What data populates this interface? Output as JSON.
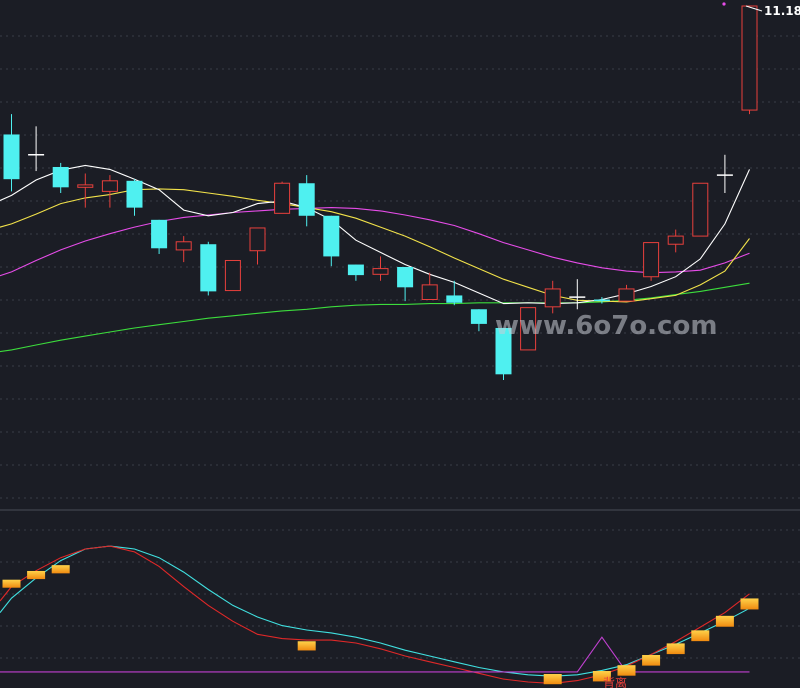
{
  "chart_data": [
    {
      "type": "candlestick",
      "title": "",
      "price_label": "11.18",
      "watermark": "www.6o7o.com",
      "ylim": [
        5.6,
        11.4
      ],
      "colors": {
        "up": "#e8403c",
        "down": "#4ff0f0",
        "doji": "#ffffff",
        "ma5": "#ffffff",
        "ma10": "#f2e24a",
        "ma20": "#e64ce8",
        "ma60": "#3cdc3c",
        "grid": "#3a3d48",
        "background": "#1b1d25"
      },
      "candles": [
        {
          "o": 9.6,
          "h": 9.85,
          "l": 8.9,
          "c": 9.05
        },
        {
          "o": 9.35,
          "h": 9.7,
          "l": 9.15,
          "c": 9.35
        },
        {
          "o": 9.2,
          "h": 9.25,
          "l": 8.88,
          "c": 8.95
        },
        {
          "o": 8.95,
          "h": 9.12,
          "l": 8.7,
          "c": 8.98
        },
        {
          "o": 8.9,
          "h": 9.1,
          "l": 8.7,
          "c": 9.03
        },
        {
          "o": 9.03,
          "h": 9.05,
          "l": 8.6,
          "c": 8.7
        },
        {
          "o": 8.55,
          "h": 8.55,
          "l": 8.13,
          "c": 8.2
        },
        {
          "o": 8.18,
          "h": 8.35,
          "l": 8.03,
          "c": 8.28
        },
        {
          "o": 8.25,
          "h": 8.28,
          "l": 7.62,
          "c": 7.67
        },
        {
          "o": 7.68,
          "h": 8.05,
          "l": 7.68,
          "c": 8.05
        },
        {
          "o": 8.17,
          "h": 8.45,
          "l": 8.0,
          "c": 8.45
        },
        {
          "o": 8.63,
          "h": 9.02,
          "l": 8.63,
          "c": 9.0
        },
        {
          "o": 9.0,
          "h": 9.1,
          "l": 8.47,
          "c": 8.6
        },
        {
          "o": 8.6,
          "h": 8.6,
          "l": 7.98,
          "c": 8.1
        },
        {
          "o": 8.0,
          "h": 8.0,
          "l": 7.8,
          "c": 7.87
        },
        {
          "o": 7.88,
          "h": 8.1,
          "l": 7.8,
          "c": 7.95
        },
        {
          "o": 7.97,
          "h": 7.97,
          "l": 7.55,
          "c": 7.72
        },
        {
          "o": 7.57,
          "h": 7.9,
          "l": 7.57,
          "c": 7.75
        },
        {
          "o": 7.62,
          "h": 7.8,
          "l": 7.5,
          "c": 7.53
        },
        {
          "o": 7.45,
          "h": 7.45,
          "l": 7.18,
          "c": 7.27
        },
        {
          "o": 7.22,
          "h": 7.22,
          "l": 6.58,
          "c": 6.65
        },
        {
          "o": 6.95,
          "h": 7.47,
          "l": 6.95,
          "c": 7.47
        },
        {
          "o": 7.48,
          "h": 7.8,
          "l": 7.4,
          "c": 7.7
        },
        {
          "o": 7.6,
          "h": 7.82,
          "l": 7.45,
          "c": 7.6
        },
        {
          "o": 7.57,
          "h": 7.6,
          "l": 7.52,
          "c": 7.55
        },
        {
          "o": 7.55,
          "h": 7.75,
          "l": 7.55,
          "c": 7.7
        },
        {
          "o": 7.85,
          "h": 8.27,
          "l": 7.8,
          "c": 8.27
        },
        {
          "o": 8.25,
          "h": 8.43,
          "l": 8.15,
          "c": 8.35
        },
        {
          "o": 8.35,
          "h": 9.0,
          "l": 8.35,
          "c": 9.0
        },
        {
          "o": 9.1,
          "h": 9.35,
          "l": 8.88,
          "c": 9.1
        },
        {
          "o": 9.9,
          "h": 11.18,
          "l": 9.85,
          "c": 11.18
        }
      ],
      "ma5": [
        8.85,
        9.04,
        9.16,
        9.22,
        9.17,
        9.05,
        8.92,
        8.67,
        8.6,
        8.64,
        8.75,
        8.78,
        8.7,
        8.55,
        8.3,
        8.15,
        8.0,
        7.88,
        7.78,
        7.65,
        7.52,
        7.53,
        7.52,
        7.53,
        7.57,
        7.64,
        7.73,
        7.85,
        8.07,
        8.5,
        9.17
      ],
      "ma10": [
        8.5,
        8.62,
        8.75,
        8.82,
        8.86,
        8.92,
        8.93,
        8.92,
        8.88,
        8.84,
        8.79,
        8.75,
        8.7,
        8.65,
        8.57,
        8.46,
        8.35,
        8.22,
        8.08,
        7.95,
        7.82,
        7.72,
        7.62,
        7.56,
        7.55,
        7.54,
        7.58,
        7.62,
        7.75,
        7.92,
        8.32
      ],
      "ma20": [
        7.91,
        8.05,
        8.18,
        8.29,
        8.38,
        8.46,
        8.53,
        8.58,
        8.61,
        8.64,
        8.66,
        8.68,
        8.69,
        8.7,
        8.69,
        8.66,
        8.61,
        8.55,
        8.48,
        8.38,
        8.27,
        8.18,
        8.09,
        8.02,
        7.96,
        7.92,
        7.9,
        7.91,
        7.93,
        8.02,
        8.14
      ],
      "ma60": [
        6.95,
        7.01,
        7.07,
        7.12,
        7.17,
        7.22,
        7.26,
        7.3,
        7.34,
        7.37,
        7.4,
        7.43,
        7.45,
        7.48,
        7.5,
        7.51,
        7.51,
        7.52,
        7.52,
        7.53,
        7.53,
        7.53,
        7.53,
        7.53,
        7.54,
        7.56,
        7.59,
        7.63,
        7.67,
        7.72,
        7.77
      ]
    },
    {
      "type": "line",
      "annotation": "背离",
      "series": [
        {
          "name": "",
          "color": "#40e0e0",
          "values": [
            0.52,
            0.66,
            0.78,
            0.86,
            0.88,
            0.86,
            0.8,
            0.7,
            0.58,
            0.47,
            0.39,
            0.33,
            0.3,
            0.28,
            0.25,
            0.21,
            0.16,
            0.12,
            0.08,
            0.04,
            0.01,
            -0.01,
            -0.02,
            -0.01,
            0.02,
            0.06,
            0.13,
            0.2,
            0.28,
            0.36,
            0.45
          ]
        },
        {
          "name": "",
          "color": "#e02828",
          "values": [
            0.6,
            0.71,
            0.8,
            0.86,
            0.88,
            0.84,
            0.74,
            0.6,
            0.47,
            0.36,
            0.27,
            0.24,
            0.23,
            0.23,
            0.21,
            0.17,
            0.12,
            0.08,
            0.04,
            0.0,
            -0.04,
            -0.06,
            -0.07,
            -0.05,
            -0.01,
            0.05,
            0.13,
            0.22,
            0.32,
            0.42,
            0.55
          ]
        },
        {
          "name": "",
          "color": "#c040d0",
          "values": [
            0.01,
            0.01,
            0.01,
            0.01,
            0.01,
            0.01,
            0.01,
            0.01,
            0.01,
            0.01,
            0.01,
            0.01,
            0.01,
            0.01,
            0.01,
            0.01,
            0.01,
            0.01,
            0.01,
            0.01,
            0.01,
            0.01,
            0.01,
            0.01,
            0.25,
            0.01,
            0.01,
            0.01,
            0.01,
            0.01,
            0.01
          ]
        }
      ],
      "markers": [
        {
          "i": 0,
          "v": 0.62
        },
        {
          "i": 1,
          "v": 0.68
        },
        {
          "i": 2,
          "v": 0.72
        },
        {
          "i": 12,
          "v": 0.19
        },
        {
          "i": 22,
          "v": -0.04
        },
        {
          "i": 24,
          "v": -0.02
        },
        {
          "i": 25,
          "v": 0.02
        },
        {
          "i": 26,
          "v": 0.09
        },
        {
          "i": 27,
          "v": 0.17
        },
        {
          "i": 28,
          "v": 0.26
        },
        {
          "i": 29,
          "v": 0.36
        },
        {
          "i": 30,
          "v": 0.48
        }
      ],
      "ylim": [
        -0.06,
        0.95
      ]
    }
  ]
}
